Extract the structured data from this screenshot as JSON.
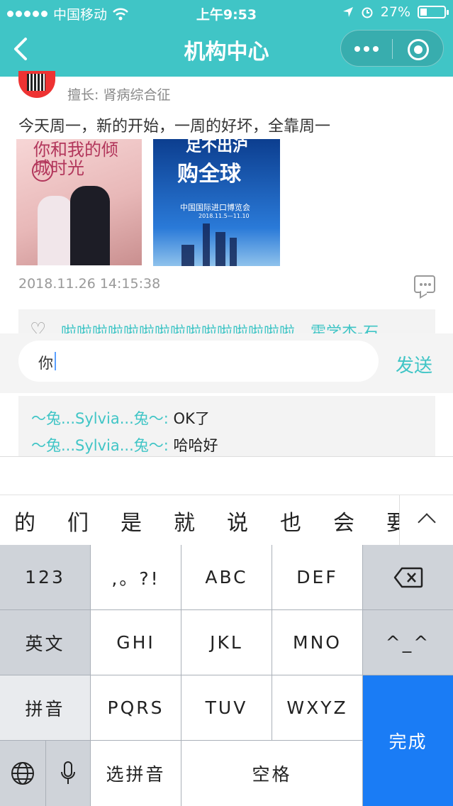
{
  "status": {
    "carrier": "中国移动",
    "time": "上午9:53",
    "battery": "27%",
    "battery_level": 0.27
  },
  "nav": {
    "title": "机构中心"
  },
  "post": {
    "specialty": "擅长: 肾病综合征",
    "text": "今天周一，新的开始，一周的好坏，全靠周一",
    "image1_title": "你和我的倾城时光",
    "image2_line1": "足不出沪",
    "image2_line2": "购全球",
    "image2_line3": "中国国际进口博览会",
    "image2_line4": "2018.11.5—11.10",
    "time": "2018.11.26 14:15:38"
  },
  "likes": {
    "text": "啦啦啦啦啦啦啦啦啦啦啦啦啦啦啦、霍学杰-石"
  },
  "input": {
    "value": "你",
    "send_label": "发送"
  },
  "comments": [
    {
      "name": "～兔...Sylvia...兔～:",
      "text": "OK了"
    },
    {
      "name": "～兔...Sylvia...兔～:",
      "text": "哈哈好"
    }
  ],
  "candidates": [
    "的",
    "们",
    "是",
    "就",
    "说",
    "也",
    "会",
    "要"
  ],
  "keyboard": {
    "row1": [
      "123",
      ",。?!",
      "ABC",
      "DEF"
    ],
    "row2": [
      "英文",
      "GHI",
      "JKL",
      "MNO",
      "^_^"
    ],
    "row3": [
      "拼音",
      "PQRS",
      "TUV",
      "WXYZ"
    ],
    "row4": [
      "选拼音",
      "空格"
    ],
    "done": "完成"
  }
}
